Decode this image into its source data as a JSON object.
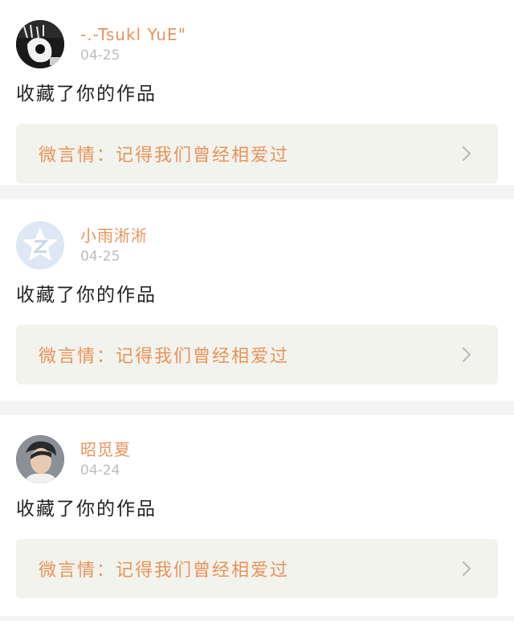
{
  "items": [
    {
      "username": "-.-Tsukl YuE\"",
      "date": "04-25",
      "action": "收藏了你的作品",
      "work_title": "微言情：记得我们曾经相爱过",
      "avatar_icon": "monochrome-photo-avatar"
    },
    {
      "username": "小雨淅淅",
      "date": "04-25",
      "action": "收藏了你的作品",
      "work_title": "微言情：记得我们曾经相爱过",
      "avatar_icon": "qzone-star-avatar"
    },
    {
      "username": "昭觅夏",
      "date": "04-24",
      "action": "收藏了你的作品",
      "work_title": "微言情：记得我们曾经相爱过",
      "avatar_icon": "portrait-photo-avatar"
    }
  ],
  "colors": {
    "accent": "#e8935a",
    "date": "#bdbdbd",
    "link_bg": "#f3f3ed",
    "divider": "#f4f4f4"
  }
}
